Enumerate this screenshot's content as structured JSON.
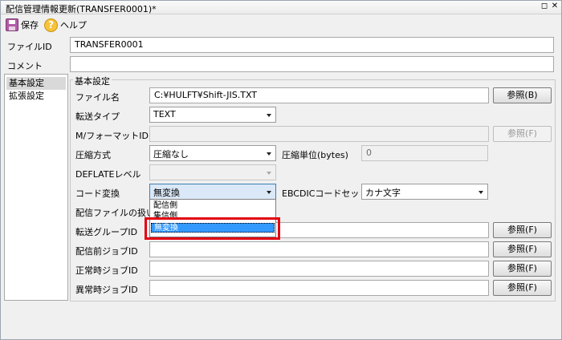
{
  "window": {
    "title": "配信管理情報更新(TRANSFER0001)*",
    "restore_glyph": "◻",
    "close_glyph": "✕"
  },
  "toolbar": {
    "save_label": "保存",
    "help_label": "ヘルプ",
    "help_glyph": "?"
  },
  "form": {
    "file_id_label": "ファイルID",
    "file_id_value": "TRANSFER0001",
    "comment_label": "コメント",
    "comment_value": ""
  },
  "sidebar": {
    "items": [
      {
        "label": "基本設定"
      },
      {
        "label": "拡張設定"
      }
    ]
  },
  "basic": {
    "group_title": "基本設定",
    "filename_label": "ファイル名",
    "filename_value": "C:¥HULFT¥Shift-JIS.TXT",
    "browse_label": "参照(B)",
    "transfer_type_label": "転送タイプ",
    "transfer_type_value": "TEXT",
    "mformat_label": "M/フォーマットID",
    "mformat_value": "",
    "mformat_browse_label": "参照(F)",
    "compress_label": "圧縮方式",
    "compress_value": "圧縮なし",
    "compress_unit_label": "圧縮単位(bytes)",
    "compress_unit_value": "0",
    "deflate_label": "DEFLATEレベル",
    "deflate_value": "",
    "code_label": "コード変換",
    "code_value": "無変換",
    "ebcdic_label": "EBCDICコードセット",
    "ebcdic_value": "カナ文字",
    "handling_label": "配信ファイルの扱い",
    "group_label": "転送グループID",
    "group_browse_label": "参照(F)",
    "pre_job_label": "配信前ジョブID",
    "pre_job_browse_label": "参照(F)",
    "ok_job_label": "正常時ジョブID",
    "ok_job_browse_label": "参照(F)",
    "err_job_label": "異常時ジョブID",
    "err_job_browse_label": "参照(F)",
    "code_options": [
      "配信側",
      "集信側",
      "無変換"
    ]
  },
  "colors": {
    "highlight": "#e3000f",
    "selection": "#3399ff"
  }
}
